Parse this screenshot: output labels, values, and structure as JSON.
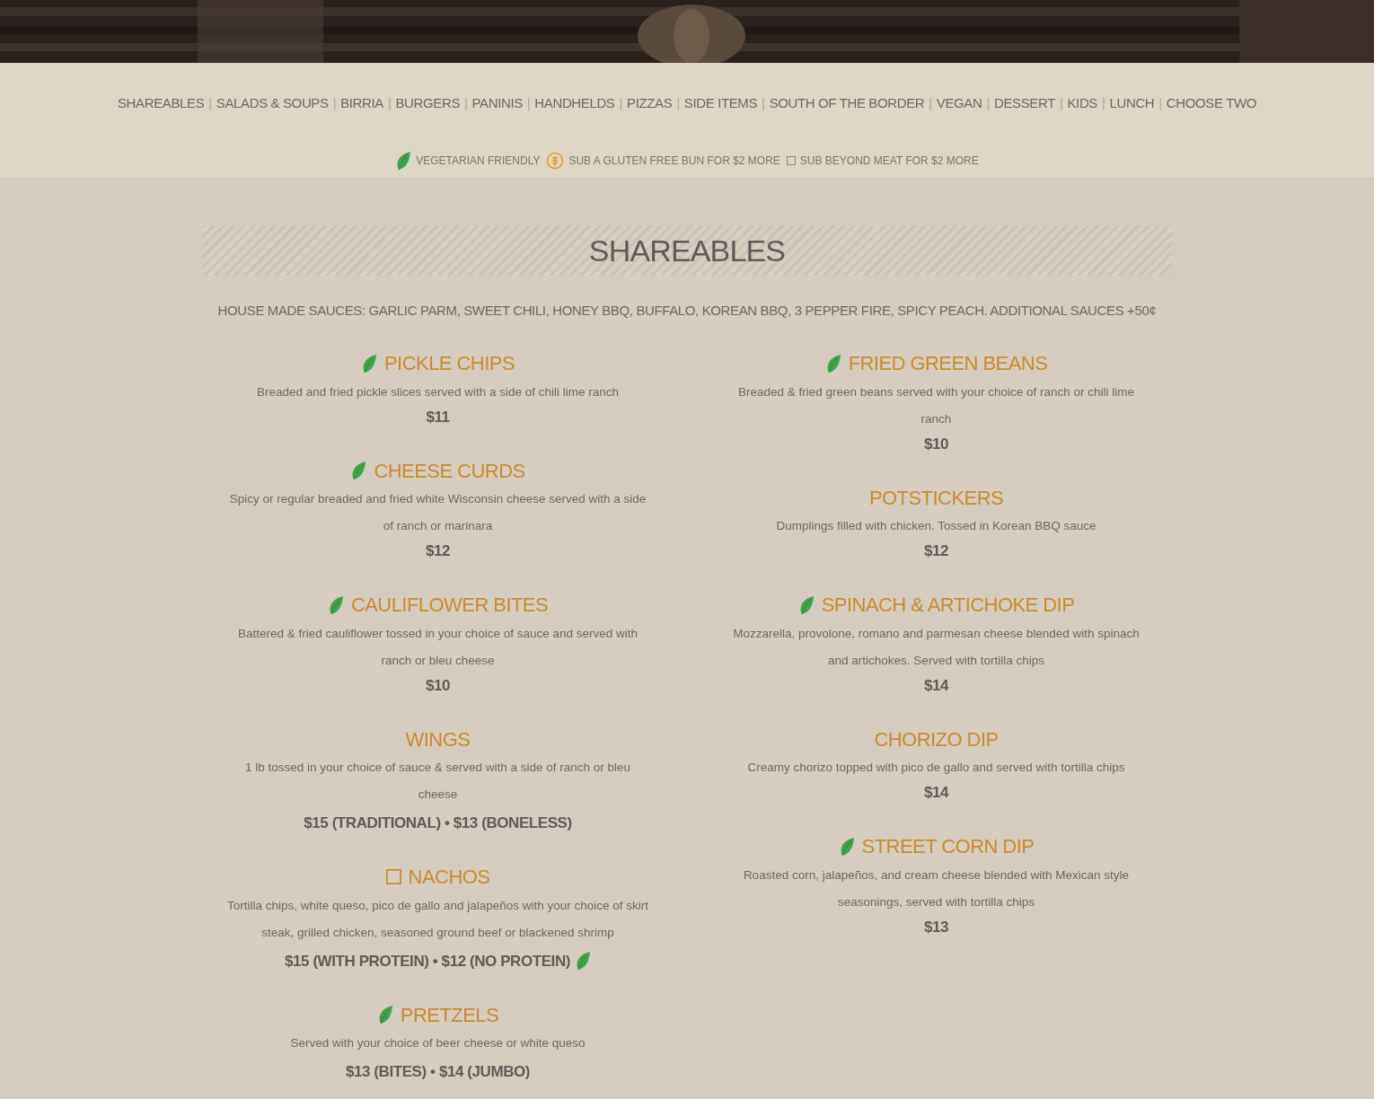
{
  "nav": [
    {
      "label": "SHAREABLES"
    },
    {
      "label": "SALADS & SOUPS"
    },
    {
      "label": "BIRRIA"
    },
    {
      "label": "BURGERS"
    },
    {
      "label": "PANINIS"
    },
    {
      "label": "HANDHELDS"
    },
    {
      "label": "PIZZAS"
    },
    {
      "label": "SIDE ITEMS"
    },
    {
      "label": "SOUTH OF THE BORDER"
    },
    {
      "label": "VEGAN"
    },
    {
      "label": "DESSERT"
    },
    {
      "label": "KIDS"
    },
    {
      "label": "LUNCH"
    },
    {
      "label": "CHOOSE TWO"
    }
  ],
  "nav_separator": "|",
  "legend": [
    {
      "kind": "vegetarian",
      "text": "VEGETARIAN FRIENDLY"
    },
    {
      "kind": "gluten_free",
      "text": "SUB A GLUTEN FREE BUN FOR $2 MORE"
    },
    {
      "kind": "beyond_meat",
      "text": "SUB BEYOND MEAT FOR $2 MORE"
    }
  ],
  "section": {
    "title": "SHAREABLES",
    "note": "HOUSE MADE SAUCES: GARLIC PARM, SWEET CHILI, HONEY BBQ, BUFFALO, KOREAN BBQ, 3 PEPPER FIRE, SPICY PEACH. ADDITIONAL SAUCES +50¢"
  },
  "columns": [
    [
      {
        "vegetarian": true,
        "beyond_meat": false,
        "name": "PICKLE CHIPS",
        "description": "Breaded and fried pickle slices served with a side of chili lime ranch",
        "price": "$11",
        "price_vegetarian": false
      },
      {
        "vegetarian": true,
        "beyond_meat": false,
        "name": "CHEESE CURDS",
        "description": "Spicy or regular breaded and fried white Wisconsin cheese served with a side of ranch or marinara",
        "price": "$12",
        "price_vegetarian": false
      },
      {
        "vegetarian": true,
        "beyond_meat": false,
        "name": "CAULIFLOWER BITES",
        "description": "Battered & fried cauliflower tossed in your choice of sauce and served with ranch or bleu cheese",
        "price": "$10",
        "price_vegetarian": false
      },
      {
        "vegetarian": false,
        "beyond_meat": false,
        "name": "WINGS",
        "description": "1 lb tossed in your choice of sauce & served with a side of ranch or bleu cheese",
        "price": "$15 (TRADITIONAL) • $13 (BONELESS)",
        "price_vegetarian": false
      },
      {
        "vegetarian": false,
        "beyond_meat": true,
        "name": "NACHOS",
        "description": "Tortilla chips, white queso, pico de gallo and jalapeños with your choice of skirt steak, grilled chicken, seasoned ground beef or blackened shrimp",
        "price": "$15 (WITH PROTEIN) • $12 (NO PROTEIN)",
        "price_vegetarian": true
      },
      {
        "vegetarian": true,
        "beyond_meat": false,
        "name": "PRETZELS",
        "description": "Served with your choice of beer cheese or white queso",
        "price": "$13 (BITES) • $14 (JUMBO)",
        "price_vegetarian": false
      }
    ],
    [
      {
        "vegetarian": true,
        "beyond_meat": false,
        "name": "FRIED GREEN BEANS",
        "description": "Breaded & fried green beans served with your choice of ranch or chili lime ranch",
        "price": "$10",
        "price_vegetarian": false
      },
      {
        "vegetarian": false,
        "beyond_meat": false,
        "name": "POTSTICKERS",
        "description": "Dumplings filled with chicken. Tossed in Korean BBQ sauce",
        "price": "$12",
        "price_vegetarian": false
      },
      {
        "vegetarian": true,
        "beyond_meat": false,
        "name": "SPINACH & ARTICHOKE DIP",
        "description": "Mozzarella, provolone, romano and parmesan cheese blended with spinach and artichokes. Served with tortilla chips",
        "price": "$14",
        "price_vegetarian": false
      },
      {
        "vegetarian": false,
        "beyond_meat": false,
        "name": "CHORIZO DIP",
        "description": "Creamy chorizo topped with pico de gallo and served with tortilla chips",
        "price": "$14",
        "price_vegetarian": false
      },
      {
        "vegetarian": true,
        "beyond_meat": false,
        "name": "STREET CORN DIP",
        "description": "Roasted corn, jalapeños, and cream cheese blended with Mexican style seasonings, served with tortilla chips",
        "price": "$13",
        "price_vegetarian": false
      }
    ]
  ]
}
